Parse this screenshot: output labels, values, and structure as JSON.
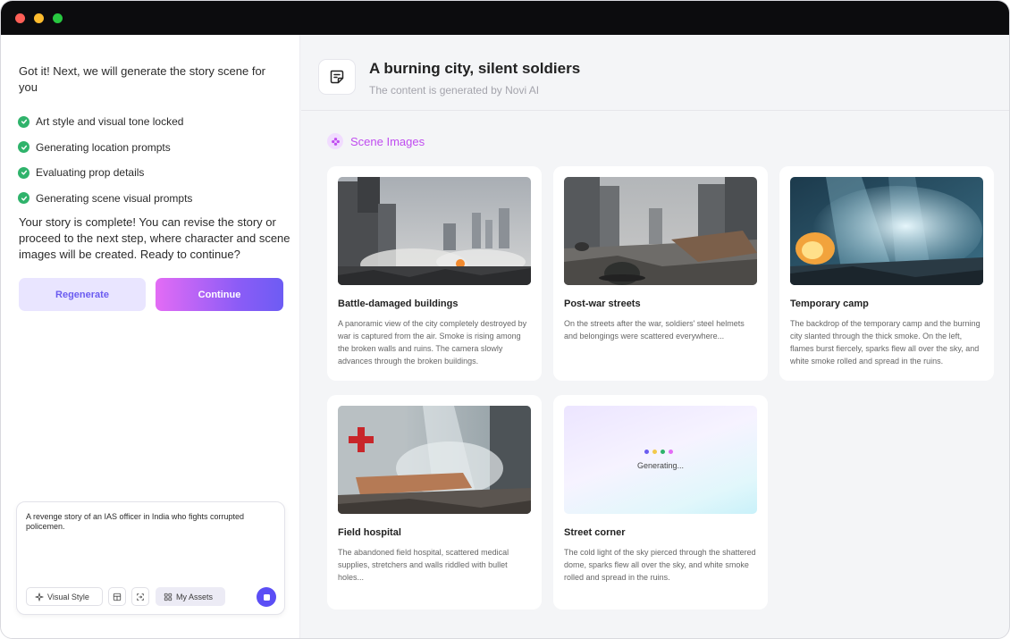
{
  "window": {
    "controls": [
      "close",
      "minimize",
      "zoom"
    ]
  },
  "chat": {
    "intro": "Got it! Next, we will generate the story scene for you",
    "steps": [
      {
        "label": "Art style and visual tone locked"
      },
      {
        "label": "Generating location prompts"
      },
      {
        "label": "Evaluating prop details"
      },
      {
        "label": "Generating scene visual prompts"
      }
    ],
    "complete": "Your story is complete!  You can revise the story or proceed to the next step, where character and scene images will be created.  Ready to continue?",
    "regenerate_label": "Regenerate",
    "continue_label": "Continue"
  },
  "composer": {
    "text": "A revenge story of an IAS officer in India who fights corrupted policemen.",
    "visual_style_label": "Visual Style",
    "my_assets_label": "My Assets"
  },
  "header": {
    "title": "A burning city, silent soldiers",
    "subtitle": "The content is generated by Novi AI"
  },
  "section": {
    "title": "Scene Images"
  },
  "scenes": [
    {
      "title": "Battle-damaged buildings",
      "description": "A panoramic view of the city completely destroyed by war is captured from the air. Smoke is rising among the broken walls and ruins. The camera slowly advances through the broken buildings.",
      "image": "ruined-city-skyline"
    },
    {
      "title": "Post-war streets",
      "description": "On the streets after the war, soldiers' steel helmets and belongings were scattered everywhere...",
      "image": "war-street-helmets"
    },
    {
      "title": "Temporary camp",
      "description": "The backdrop of the temporary camp and the burning city slanted through the thick smoke. On the left, flames burst fiercely, sparks flew all over the sky, and white smoke rolled and spread in the ruins.",
      "image": "smoke-flames-camp"
    },
    {
      "title": "Field hospital",
      "description": "The abandoned field hospital, scattered medical supplies, stretchers and walls riddled with bullet holes...",
      "image": "abandoned-field-hospital"
    },
    {
      "title": "Street corner",
      "description": "The cold light of the sky pierced through the shattered dome, sparks flew all over the sky, and white smoke rolled and spread in the ruins.",
      "image": "generating",
      "status": "Generating..."
    }
  ],
  "colors": {
    "accent": "#6b5cf0",
    "continue_gradient_start": "#e36cf5",
    "continue_gradient_end": "#6d5cf4",
    "section_title": "#c04cf0",
    "check": "#2fb36b",
    "send": "#5b4ef5",
    "generating_dots": [
      "#6b5cf0",
      "#f2c94c",
      "#2fb36b",
      "#e36cf5"
    ]
  }
}
